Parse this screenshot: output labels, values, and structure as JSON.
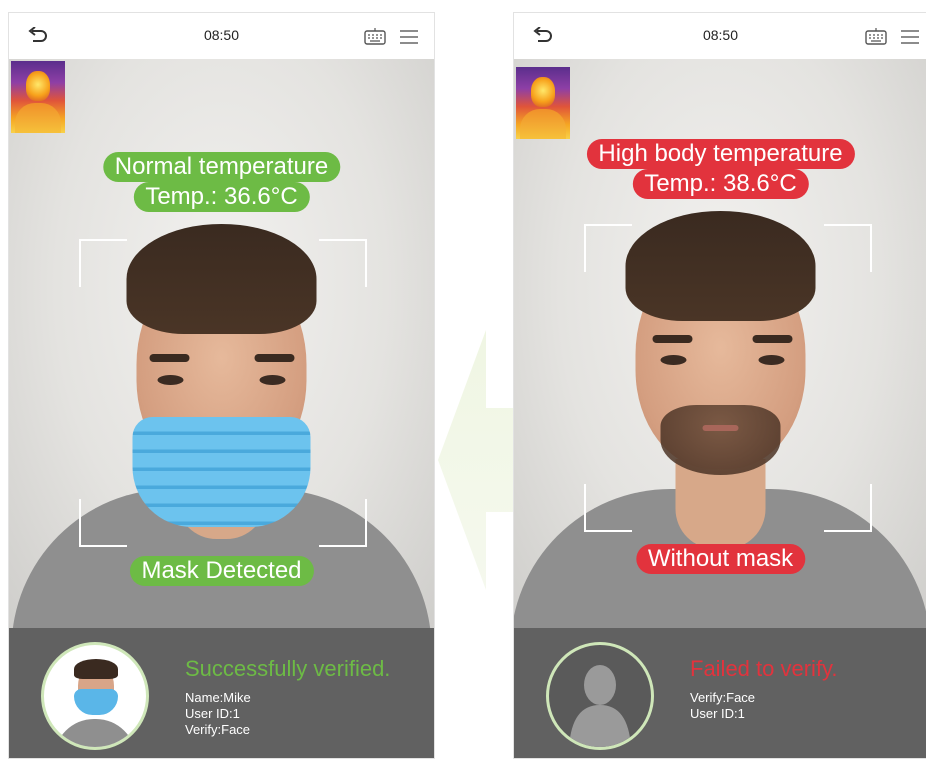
{
  "left_screen": {
    "clock": "08:50",
    "temperature_status": "Normal temperature",
    "temperature_reading": "Temp.: 36.6°C",
    "mask_status": "Mask Detected",
    "result_title": "Successfully verified.",
    "details": [
      "Name:Mike",
      "User ID:1",
      "Verify:Face"
    ],
    "status_color": "#6dbb45"
  },
  "right_screen": {
    "clock": "08:50",
    "temperature_status": "High body temperature",
    "temperature_reading": "Temp.: 38.6°C",
    "mask_status": "Without mask",
    "result_title": "Failed to verify.",
    "details": [
      "Verify:Face",
      "User ID:1"
    ],
    "status_color": "#e2333d"
  },
  "icons": {
    "back": "back-arrow-icon",
    "keyboard": "keyboard-icon",
    "menu": "menu-icon"
  }
}
